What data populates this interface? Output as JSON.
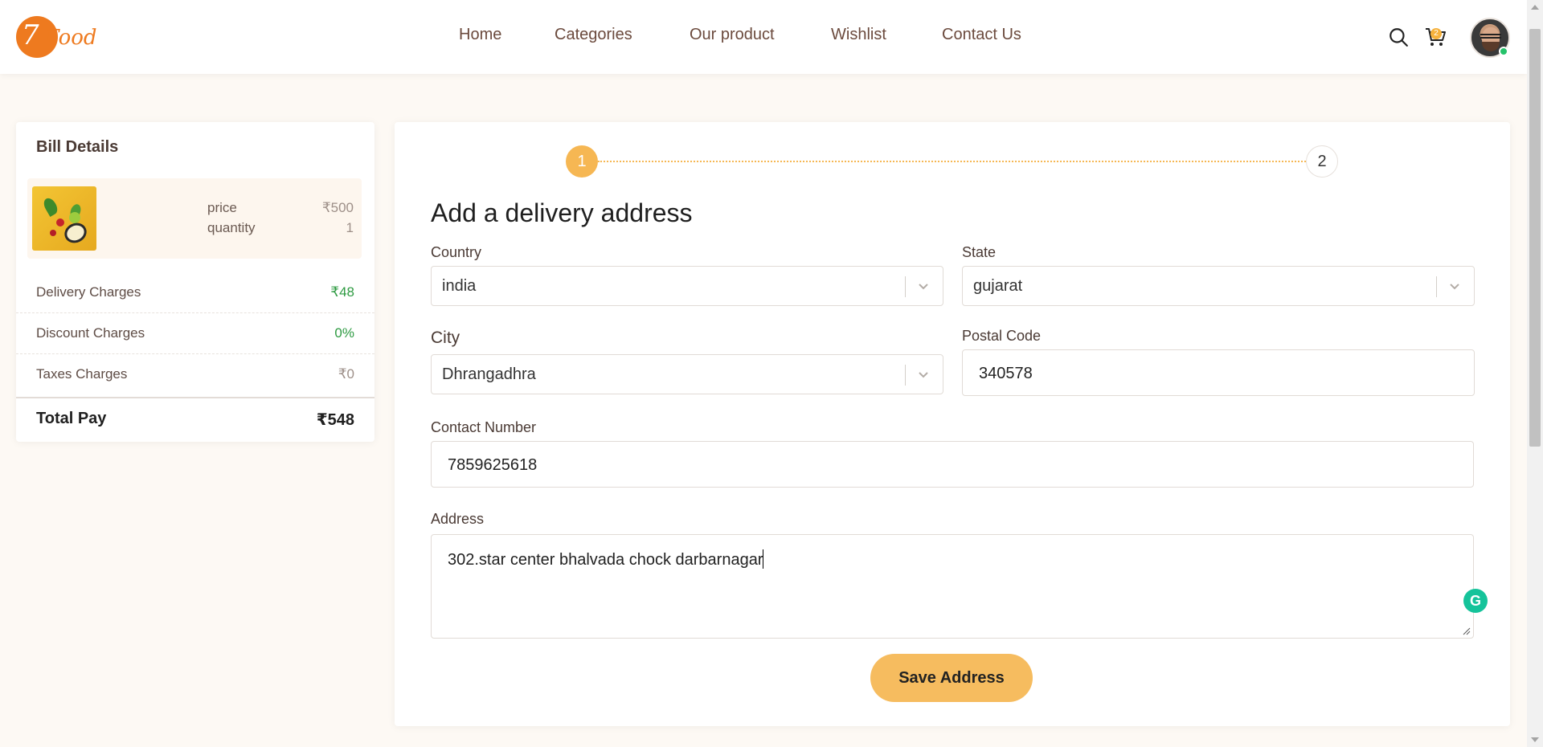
{
  "brand": {
    "logo_initial": "7",
    "logo_text": "Food"
  },
  "nav": {
    "items": [
      {
        "label": "Home"
      },
      {
        "label": "Categories"
      },
      {
        "label": "Our product"
      },
      {
        "label": "Wishlist"
      },
      {
        "label": "Contact Us"
      }
    ]
  },
  "header_actions": {
    "search_icon": "search-icon",
    "cart_icon": "cart-icon",
    "cart_count": "2"
  },
  "bill": {
    "title": "Bill Details",
    "item": {
      "price_label": "price",
      "price_value": "₹500",
      "quantity_label": "quantity",
      "quantity_value": "1"
    },
    "rows": [
      {
        "label": "Delivery Charges",
        "value": "₹48",
        "color": "#2d9a41"
      },
      {
        "label": "Discount Charges",
        "value": "0%",
        "color": "#2d9a41"
      },
      {
        "label": "Taxes Charges",
        "value": "₹0",
        "color": "#9d8f88"
      }
    ],
    "total_label": "Total Pay",
    "total_value": "₹548"
  },
  "steps": {
    "step1": "1",
    "step2": "2",
    "active": 1
  },
  "form": {
    "title": "Add a delivery address",
    "country": {
      "label": "Country",
      "value": "india"
    },
    "state": {
      "label": "State",
      "value": "gujarat"
    },
    "city": {
      "label": "City",
      "value": "Dhrangadhra"
    },
    "postal": {
      "label": "Postal Code",
      "value": "340578"
    },
    "contact": {
      "label": "Contact Number",
      "value": "7859625618"
    },
    "address": {
      "label": "Address",
      "value": "302.star center bhalvada chock darbarnagar"
    },
    "save_label": "Save Address"
  },
  "colors": {
    "accent": "#f6b753",
    "brand": "#ee7a1f",
    "success": "#2d9a41"
  }
}
